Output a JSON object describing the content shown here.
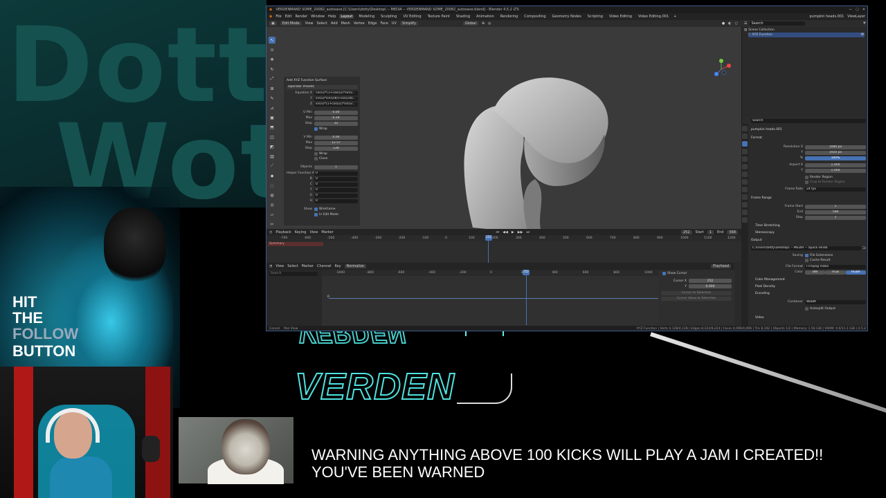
{
  "overlay": {
    "bg_text_line1": "Dotty",
    "bg_text_line2": "Wots",
    "follow_line1": "HIT",
    "follow_line2": "THE",
    "follow_line3": "FOLLOW",
    "follow_line4": "BUTTON",
    "logo_mirrored": "VERDEN",
    "logo": "VERDEN",
    "warning_line1": "WARNING ANYTHING ABOVE 100 KICKS WILL PLAY A JAM I CREATED!!",
    "warning_line2": "YOU'VE BEEN WARNED",
    "accent_cyan": "#4fe3e0"
  },
  "blender": {
    "title": "VERDENMAND SOME_20082_autosave [C:\\Users\\dotty\\Desktop\\ -- MEDIA -- VERDENMAND SOME_20082_autosave.blend] - Blender 4.5.2 LTS",
    "menu": [
      "File",
      "Edit",
      "Render",
      "Window",
      "Help"
    ],
    "workspaces": [
      "Layout",
      "Modeling",
      "Sculpting",
      "UV Editing",
      "Texture Paint",
      "Shading",
      "Animation",
      "Rendering",
      "Compositing",
      "Geometry Nodes",
      "Scripting",
      "Video Editing",
      "Video Editing.001"
    ],
    "active_workspace": "Layout",
    "scene": "pumpkin heads.001",
    "view_layer": "ViewLayer",
    "header3d": {
      "mode": "Edit Mode",
      "items": [
        "View",
        "Select",
        "Add",
        "Mesh",
        "Vertex",
        "Edge",
        "Face",
        "UV"
      ],
      "simplify": "Simplify",
      "orientation": "Global",
      "options": "Options"
    },
    "operator": {
      "title": "Add XYZ Function Surface",
      "presets": "Operator Presets",
      "eq_x_label": "Equation X",
      "eq_x": "cos(v)*(1+cos(u))*sin(v...",
      "eq_y_label": "Y",
      "eq_y": "sin(u)*sin(v/8)+cos(v/8)...",
      "eq_z_label": "Z",
      "eq_z": "sin(v)*(1+cos(u))*sin(v/...",
      "umin_label": "U Min",
      "umin": "0.00",
      "umax_label": "Max",
      "umax": "6.28",
      "ustep_label": "Step",
      "ustep": "32",
      "uwrap": "Wrap",
      "vmin_label": "V Min",
      "vmin": "0.00",
      "vmax_label": "Max",
      "vmax": "12.57",
      "vstep_label": "Step",
      "vstep": "128",
      "vwrap": "Wrap",
      "vclose": "Close",
      "objects_label": "Objects",
      "objects": "1",
      "helper_label": "Helper Function A",
      "helper_a": "0",
      "b_label": "B",
      "b": "0",
      "c_label": "C",
      "c": "0",
      "f_label": "F",
      "f": "0",
      "g_label": "G",
      "g": "0",
      "h_label": "H",
      "h": "0",
      "show_label": "Show",
      "wireframe": "Wireframe",
      "in_edit_mode": "In Edit Mode"
    },
    "timeline": {
      "items": [
        "Playback",
        "Keying",
        "View",
        "Marker"
      ],
      "current_frame": "252",
      "start_label": "Start",
      "start": "1",
      "end_label": "End",
      "end": "568",
      "ticks": [
        "-700",
        "-600",
        "-500",
        "-400",
        "-300",
        "-200",
        "-100",
        "0",
        "100",
        "200",
        "300",
        "400",
        "500",
        "600",
        "700",
        "800",
        "900",
        "1000",
        "1100",
        "1200"
      ],
      "summary": "Summary"
    },
    "graph": {
      "items": [
        "View",
        "Select",
        "Marker",
        "Channel",
        "Key"
      ],
      "normalize": "Normalize",
      "search": "Search",
      "playhead": "Playhead",
      "ticks": [
        "-1000",
        "-800",
        "-600",
        "-400",
        "-200",
        "0",
        "200",
        "400",
        "600",
        "800",
        "1000"
      ],
      "key_value": "0",
      "current": "252",
      "show_cursor": "Show Cursor",
      "cursor_x_label": "Cursor X",
      "cursor_x": "252",
      "cursor_y_label": "Y",
      "cursor_y": "0.000",
      "cursor_to_selection": "Cursor to Selection",
      "cursor_value_to_selection": "Cursor Value to Selection"
    },
    "status": {
      "cancel": "Cancel",
      "pan": "Pan View",
      "stats": "XYZ Function | Verts 4,128/4,128 | Edges 8,224/8,224 | Faces 4,096/4,096 | Tris 8,192 | Objects 1/2 | Memory: 1.56 GiB | VRAM: 0.0/11.1 GiB | 4.5.2"
    },
    "outliner": {
      "search": "Search",
      "collection": "Scene Collection",
      "item": "XYZ Function"
    },
    "properties": {
      "search": "Search",
      "object": "pumpkin heads.001",
      "format": "Format",
      "res_x_label": "Resolution X",
      "res_x": "1080 px",
      "res_y_label": "Y",
      "res_y": "1920 px",
      "res_pct_label": "%",
      "res_pct": "100%",
      "aspect_x_label": "Aspect X",
      "aspect_x": "1.000",
      "aspect_y_label": "Y",
      "aspect_y": "1.000",
      "render_region": "Render Region",
      "crop": "Crop to Render Region",
      "frame_rate_label": "Frame Rate",
      "frame_rate": "24 fps",
      "frame_range": "Frame Range",
      "frame_start_label": "Frame Start",
      "frame_start": "1",
      "end_label": "End",
      "end": "568",
      "step_label": "Step",
      "step": "1",
      "time_stretching": "Time Stretching",
      "stereoscopy": "Stereoscopy",
      "output": "Output",
      "output_path": "C:\\Users\\dotty\\Desktop\\ -- MEDIA -- \\quick renda",
      "saving_label": "Saving",
      "file_extensions": "File Extensions",
      "cache_result": "Cache Result",
      "file_format_label": "File Format",
      "file_format": "FFmpeg Video",
      "color_label": "Color",
      "color_opts": [
        "BW",
        "RGB",
        "RGBA"
      ],
      "color_mgmt": "Color Management",
      "pixel_density": "Pixel Density",
      "encoding": "Encoding",
      "container_label": "Container",
      "container": "WebM",
      "autosplit": "Autosplit Output",
      "video": "Video"
    }
  }
}
